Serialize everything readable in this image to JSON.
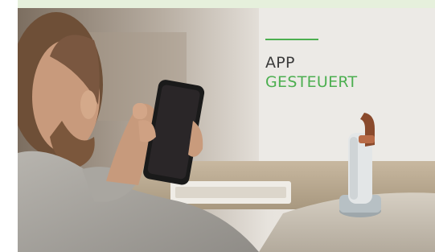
{
  "headline": {
    "line1": "APP",
    "line2": "GESTEUERT"
  },
  "colors": {
    "accent": "#4caf50",
    "top_band": "#e6f0dc"
  },
  "photo": {
    "icon": "photo-person-holding-smartphone-with-device"
  }
}
